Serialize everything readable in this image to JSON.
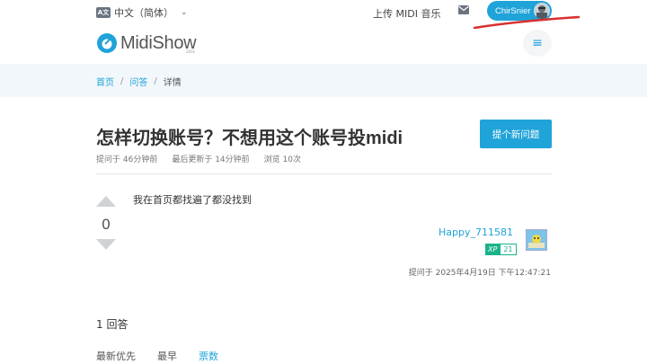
{
  "topbar": {
    "lang_icon_text": "A文",
    "language": "中文（简体）",
    "upload_link": "上传 MIDI 音乐",
    "user_name": "ChirSnier"
  },
  "header": {
    "logo_text": "MidiShow",
    "logo_sub": "2001"
  },
  "breadcrumb": {
    "items": [
      "首页",
      "问答",
      "详情"
    ],
    "separator": "/"
  },
  "question": {
    "title": "怎样切换账号？不想用这个账号投midi",
    "asked": "提问于 46分钟前",
    "updated": "最后更新于 14分钟前",
    "views": "浏览 10次",
    "votes": "0",
    "body": "我在首页都找遍了都没找到",
    "author": "Happy_711581",
    "xp_label": "XP",
    "xp_value": "21",
    "asked_at": "提问于 2025年4月19日 下午12:47:21"
  },
  "ask_button": "提个新问题",
  "answers": {
    "count_label": "1 回答",
    "sort_options": [
      "最新优先",
      "最早",
      "票数"
    ],
    "active_sort": "票数"
  },
  "colors": {
    "accent": "#1fa3d8",
    "xp_green": "#19b38a",
    "annotation_red": "#d93030"
  }
}
